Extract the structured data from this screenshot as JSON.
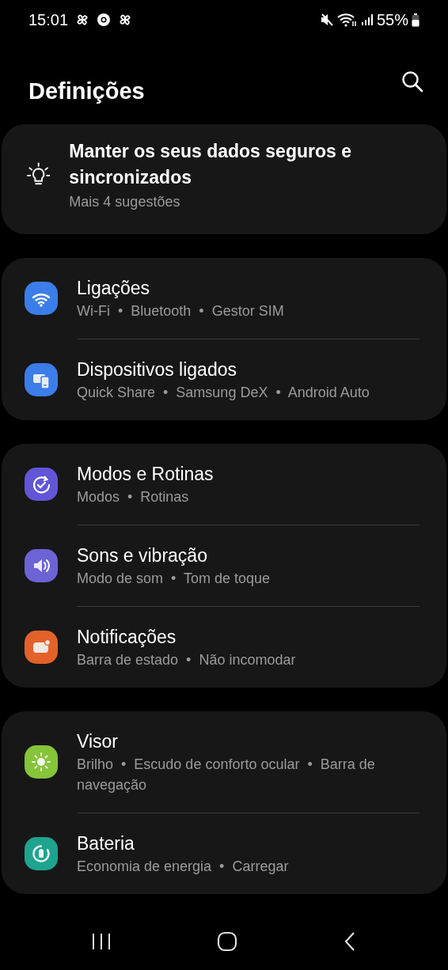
{
  "status_bar": {
    "time": "15:01",
    "battery_percent": "55%"
  },
  "header": {
    "title": "Definições"
  },
  "suggestion": {
    "title": "Manter os seus dados seguros e sincronizados",
    "subtitle": "Mais 4 sugestões"
  },
  "groups": [
    {
      "items": [
        {
          "color": "#3b7de9",
          "title": "Ligações",
          "subtitle": "Wi-Fi  •  Bluetooth  •  Gestor SIM"
        },
        {
          "color": "#3b7de9",
          "title": "Dispositivos ligados",
          "subtitle": "Quick Share  •  Samsung DeX  •  Android Auto"
        }
      ]
    },
    {
      "items": [
        {
          "color": "#6155d8",
          "title": "Modos e Rotinas",
          "subtitle": "Modos  •  Rotinas"
        },
        {
          "color": "#6b63d6",
          "title": "Sons e vibração",
          "subtitle": "Modo de som  •  Tom de toque"
        },
        {
          "color": "#e2622a",
          "title": "Notificações",
          "subtitle": "Barra de estado  •  Não incomodar"
        }
      ]
    },
    {
      "items": [
        {
          "color": "#86c43a",
          "title": "Visor",
          "subtitle": "Brilho  •  Escudo de conforto ocular  •  Barra de navegação"
        },
        {
          "color": "#1ea38f",
          "title": "Bateria",
          "subtitle": "Economia de energia  •  Carregar"
        }
      ]
    }
  ]
}
